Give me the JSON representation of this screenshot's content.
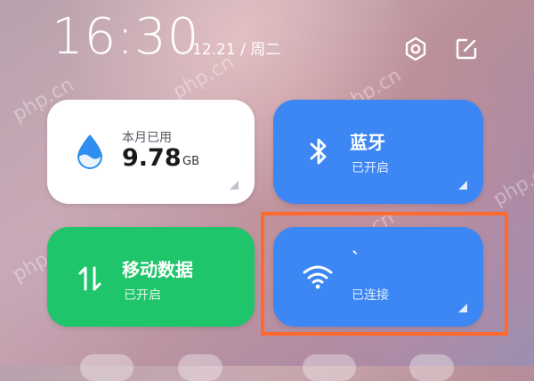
{
  "header": {
    "time": "16:30",
    "date": "12.21 / 周二",
    "settings_icon": "settings-gear-icon",
    "edit_icon": "edit-pencil-icon"
  },
  "tiles": {
    "data_usage": {
      "label": "本月已用",
      "value": "9.78",
      "unit": "GB",
      "icon": "water-drop-icon",
      "icon_color": "#2f8ef0"
    },
    "bluetooth": {
      "title": "蓝牙",
      "status": "已开启",
      "icon": "bluetooth-icon",
      "color": "#3d87f5"
    },
    "mobile_data": {
      "title": "移动数据",
      "status": "已开启",
      "icon": "data-transfer-arrows-icon",
      "color": "#1fc56a"
    },
    "wifi": {
      "title": "`",
      "status": "已连接",
      "icon": "wifi-icon",
      "color": "#3d87f5"
    }
  },
  "highlight_color": "#ff6a2c",
  "watermark": "php.cn"
}
